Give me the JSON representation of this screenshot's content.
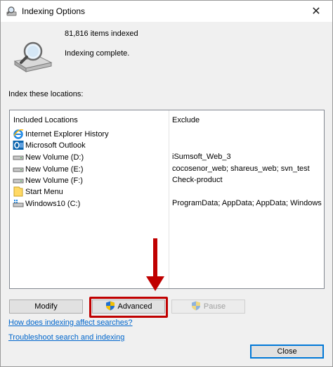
{
  "window": {
    "title": "Indexing Options",
    "close_glyph": "✕"
  },
  "status": {
    "items_indexed": "81,816 items indexed",
    "state": "Indexing complete."
  },
  "locations_label": "Index these locations:",
  "table": {
    "columns": [
      "Included Locations",
      "Exclude"
    ],
    "rows": [
      {
        "location": "Internet Explorer History",
        "exclude": "",
        "icon": "internet-explorer-icon"
      },
      {
        "location": "Microsoft Outlook",
        "exclude": "",
        "icon": "outlook-icon"
      },
      {
        "location": "New Volume (D:)",
        "exclude": "iSumsoft_Web_3",
        "icon": "drive-icon"
      },
      {
        "location": "New Volume (E:)",
        "exclude": "cocosenor_web; shareus_web; svn_test",
        "icon": "drive-icon"
      },
      {
        "location": "New Volume (F:)",
        "exclude": "Check-product",
        "icon": "drive-icon"
      },
      {
        "location": "Start Menu",
        "exclude": "",
        "icon": "folder-icon"
      },
      {
        "location": "Windows10 (C:)",
        "exclude": "ProgramData; AppData; AppData; Windows",
        "icon": "windows-drive-icon"
      }
    ]
  },
  "buttons": {
    "modify": "Modify",
    "advanced": "Advanced",
    "pause": "Pause",
    "close": "Close"
  },
  "links": {
    "how_indexing": "How does indexing affect searches?",
    "troubleshoot": "Troubleshoot search and indexing"
  },
  "colors": {
    "accent": "#0078d7",
    "highlight": "#c00000",
    "link": "#0066cc"
  }
}
